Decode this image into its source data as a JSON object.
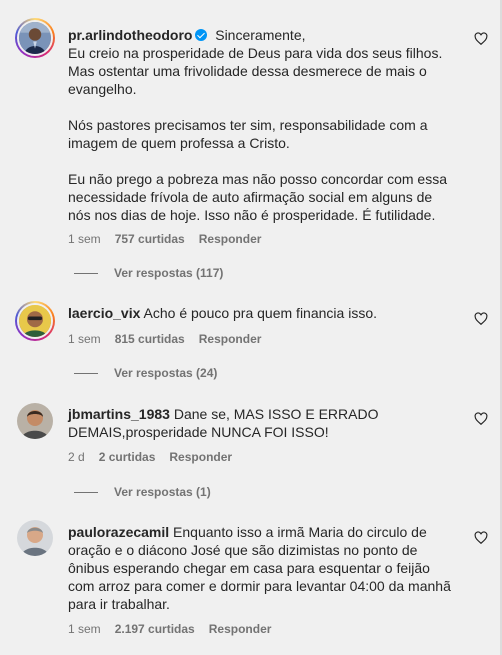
{
  "comments": [
    {
      "username": "pr.arlindotheodoro",
      "verified": true,
      "paragraphs": [
        "Sinceramente,\nEu creio na prosperidade de Deus para vida dos seus filhos. Mas ostentar uma frivolidade dessa desmerece de mais o evangelho.",
        "Nós pastores precisamos ter sim, responsabilidade com a imagem de quem professa a Cristo.",
        "Eu não prego a pobreza mas não posso concordar com essa necessidade frívola de auto afirmação social em alguns de nós nos dias de hoje. Isso não é prosperidade. É futilidade."
      ],
      "time": "1 sem",
      "likes": "757 curtidas",
      "reply": "Responder",
      "view_replies": "Ver respostas (117)"
    },
    {
      "username": "laercio_vix",
      "paragraphs": [
        "Acho é pouco pra quem financia isso."
      ],
      "time": "1 sem",
      "likes": "815 curtidas",
      "reply": "Responder",
      "view_replies": "Ver respostas (24)"
    },
    {
      "username": "jbmartins_1983",
      "paragraphs": [
        "Dane se, MAS ISSO E ERRADO DEMAIS,prosperidade NUNCA FOI ISSO!"
      ],
      "time": "2 d",
      "likes": "2 curtidas",
      "reply": "Responder",
      "view_replies": "Ver respostas (1)"
    },
    {
      "username": "paulorazecamil",
      "paragraphs": [
        "Enquanto isso a irmã Maria do circulo de oração e o diácono José que são dizimistas no ponto de ônibus esperando chegar em casa para esquentar o feijão com arroz para comer e dormir para levantar 04:00 da manhã para ir trabalhar."
      ],
      "time": "1 sem",
      "likes": "2.197 curtidas",
      "reply": "Responder"
    }
  ],
  "colors": {
    "background": "#f0f0f0",
    "text": "#262626",
    "secondary": "#737373",
    "verified": "#0095f6"
  },
  "icons": {
    "like": "heart-outline-icon",
    "verified": "verified-badge-icon"
  }
}
